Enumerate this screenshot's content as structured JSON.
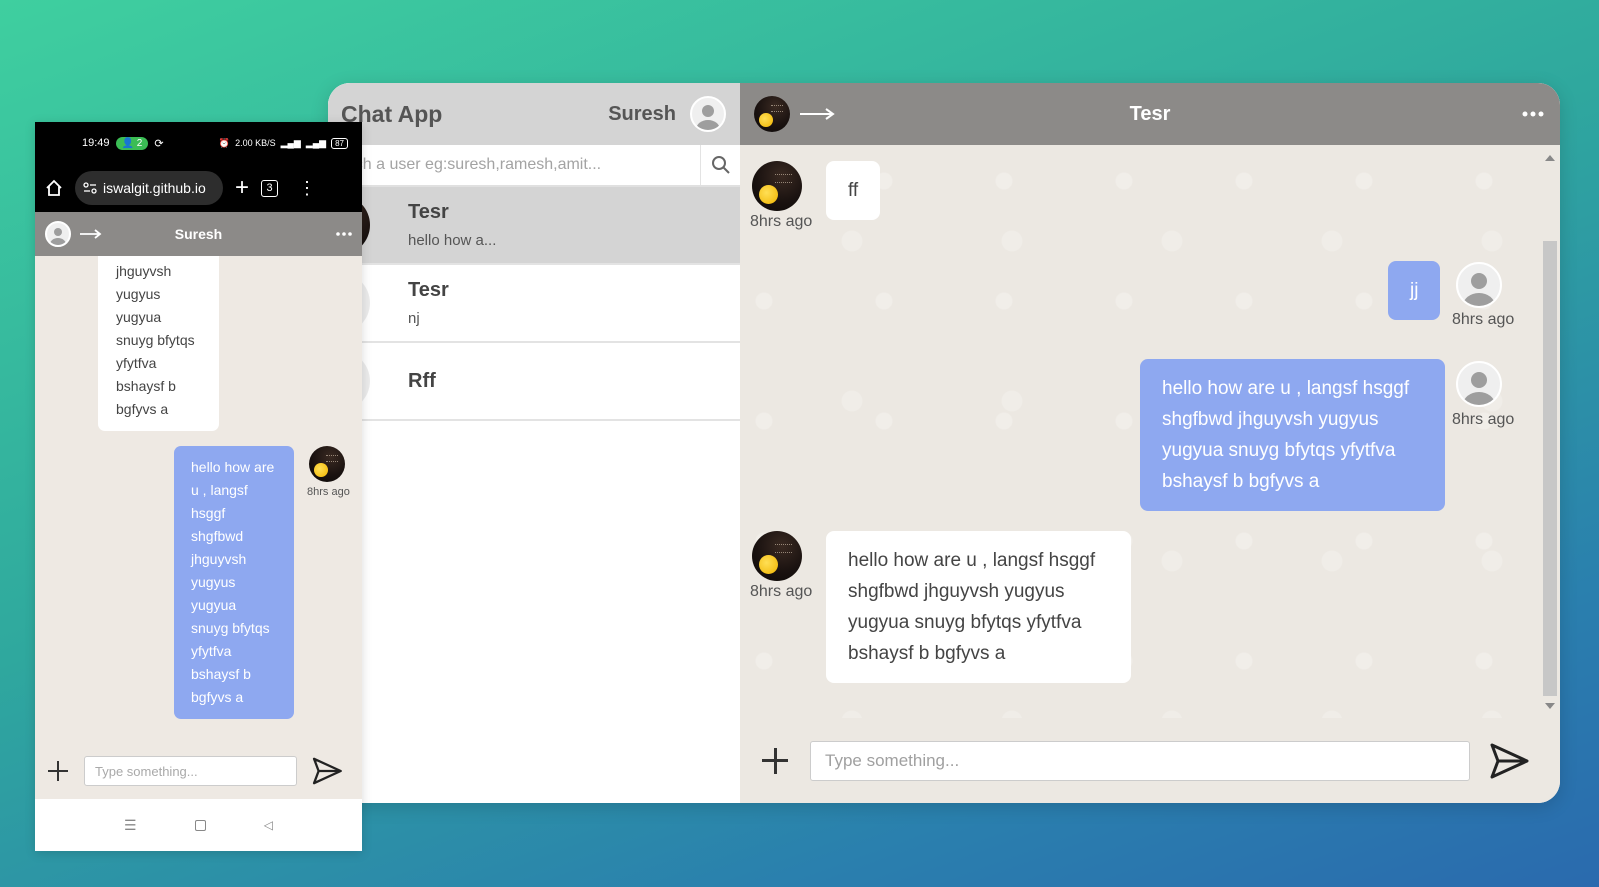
{
  "desktop": {
    "app_title": "Chat App",
    "current_user": "Suresh",
    "search": {
      "placeholder": "Search a user eg:suresh,ramesh,amit..."
    },
    "users": [
      {
        "name": "Tesr",
        "last_message": "hello how a...",
        "avatar": "emoji-avatar",
        "active": true
      },
      {
        "name": "Tesr",
        "last_message": "nj",
        "avatar": "default-avatar",
        "active": false
      },
      {
        "name": "Rff",
        "last_message": "",
        "avatar": "default-avatar",
        "active": false
      }
    ],
    "chat": {
      "title": "Tesr",
      "messages": [
        {
          "direction": "in",
          "text": "ff",
          "time": "8hrs ago"
        },
        {
          "direction": "out",
          "text": "jj",
          "time": "8hrs ago"
        },
        {
          "direction": "out",
          "text": "hello how are u , langsf hsggf shgfbwd jhguyvsh yugyus yugyua snuyg bfytqs yfytfva bshaysf b bgfyvs a",
          "time": "8hrs ago"
        },
        {
          "direction": "in",
          "text": "hello how are u , langsf hsggf shgfbwd jhguyvsh yugyus yugyua snuyg bfytqs yfytfva bshaysf b bgfyvs a",
          "time": "8hrs ago"
        }
      ],
      "input_placeholder": "Type something..."
    }
  },
  "phone": {
    "status": {
      "time": "19:49",
      "badge": "2",
      "network": "2.00 KB/S",
      "battery": "87"
    },
    "browser": {
      "url": "iswalgit.github.io",
      "tab_count": "3"
    },
    "chat": {
      "title": "Suresh",
      "incoming_lines": [
        "jhguyvsh",
        "yugyus",
        "yugyua",
        "snuyg bfytqs",
        "yfytfva",
        "bshaysf b",
        "bgfyvs a"
      ],
      "outgoing_lines": [
        "hello how are",
        "u , langsf",
        "hsggf",
        "shgfbwd",
        "jhguyvsh",
        "yugyus",
        "yugyua",
        "snuyg bfytqs",
        "yfytfva",
        "bshaysf b",
        "bgfyvs a"
      ],
      "outgoing_time": "8hrs ago",
      "input_placeholder": "Type something..."
    }
  },
  "colors": {
    "header_gray": "#8c8a88",
    "sidebar_header": "#d4d4d4",
    "outgoing_bubble": "#8ea8f0",
    "chat_bg": "#ece8e2"
  }
}
